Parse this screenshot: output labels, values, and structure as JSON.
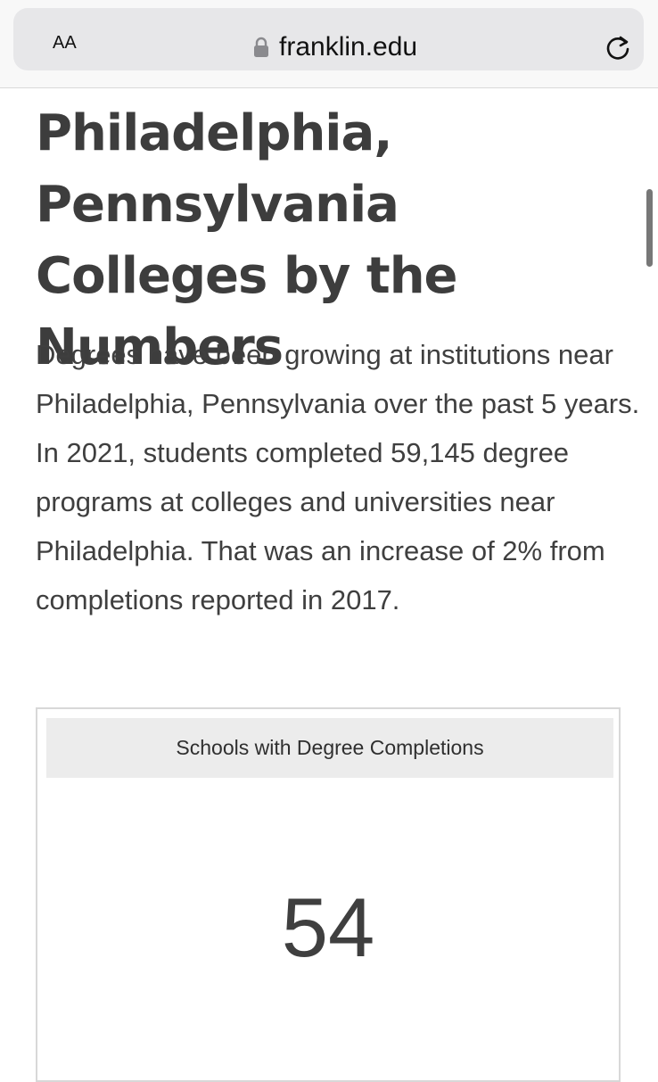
{
  "browser": {
    "text_size_label": "AA",
    "url": "franklin.edu",
    "icons": [
      "lock-icon",
      "reload-icon"
    ]
  },
  "page": {
    "title": "Philadelphia, Pennsylvania Colleges by the Numbers",
    "intro": "Degrees have been growing at institutions near Philadelphia, Pennsylvania over the past 5 years. In 2021, students completed 59,145 degree programs at colleges and universities near Philadelphia. That was an increase of 2% from completions reported in 2017."
  },
  "stat_card": {
    "label": "Schools with Degree Completions",
    "value": "54"
  },
  "colors": {
    "text": "#3f3f3f",
    "url_bar": "#e7e7e9",
    "card_header": "#ececec",
    "card_border": "#d8d8d8"
  }
}
